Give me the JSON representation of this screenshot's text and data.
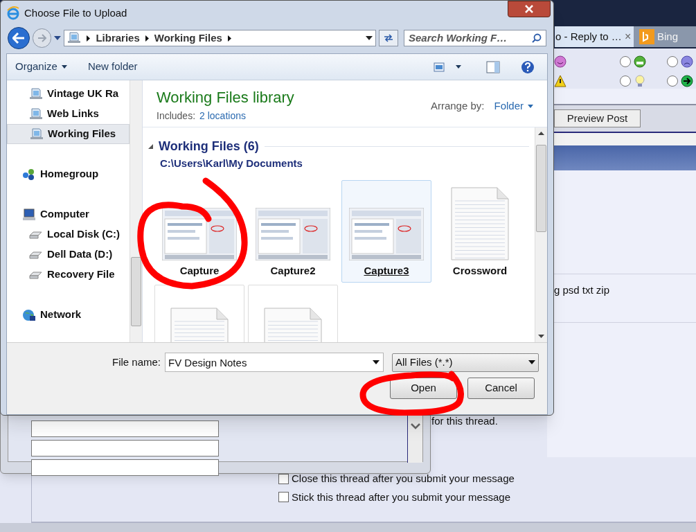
{
  "browser": {
    "tabs": [
      {
        "label": "o - Reply to …",
        "selected": true,
        "close": "×"
      },
      {
        "label": "Bing",
        "selected": false
      }
    ]
  },
  "forum": {
    "smilies": [
      {
        "kind": "pink-smile"
      },
      {
        "kind": "grin",
        "checked": false
      },
      {
        "kind": "sad",
        "checked": false
      },
      {
        "kind": "warning"
      },
      {
        "kind": "bulb",
        "checked": false
      },
      {
        "kind": "arrow",
        "checked": false
      }
    ],
    "preview_button": "Preview Post",
    "extensions_text": "g psd txt zip",
    "thread_text": "for this thread.",
    "options": [
      {
        "label": "Close this thread after you submit your message",
        "checked": false
      },
      {
        "label": "Stick this thread after you submit your message",
        "checked": false
      }
    ]
  },
  "dialog": {
    "title": "Choose File to Upload",
    "breadcrumb": [
      "Libraries",
      "Working Files"
    ],
    "search_placeholder": "Search Working F…",
    "toolbar": [
      "Organize",
      "New folder"
    ],
    "nav": [
      {
        "label": "Vintage UK Ra",
        "kind": "library",
        "selected": false
      },
      {
        "label": "Web Links",
        "kind": "library",
        "selected": false
      },
      {
        "label": "Working Files",
        "kind": "library",
        "selected": true
      },
      {
        "label": "Homegroup",
        "kind": "homegroup",
        "selected": false
      },
      {
        "label": "Computer",
        "kind": "computer",
        "selected": false,
        "children": [
          {
            "label": "Local Disk (C:)",
            "kind": "drive",
            "selected": false
          },
          {
            "label": "Dell Data (D:)",
            "kind": "drive",
            "selected": false
          },
          {
            "label": "Recovery File",
            "kind": "drive",
            "selected": false
          }
        ]
      },
      {
        "label": "Network",
        "kind": "network",
        "selected": false
      }
    ],
    "library_title": "Working Files library",
    "includes_label": "Includes:",
    "includes_link": "2 locations",
    "arrange_label": "Arrange by:",
    "arrange_value": "Folder",
    "group": {
      "title": "Working Files (6)",
      "path": "C:\\Users\\Karl\\My Documents",
      "expanded": true
    },
    "files": [
      {
        "name": "Capture",
        "kind": "screenshot",
        "selected": false
      },
      {
        "name": "Capture2",
        "kind": "screenshot",
        "selected": false
      },
      {
        "name": "Capture3",
        "kind": "screenshot",
        "selected": true
      },
      {
        "name": "Crossword",
        "kind": "document",
        "selected": false
      },
      {
        "kind": "document",
        "selected": false
      },
      {
        "kind": "document",
        "selected": false
      }
    ],
    "file_name_label": "File name:",
    "file_name_value": "FV Design Notes",
    "filter": "All Files (*.*)",
    "buttons": [
      "Open",
      "Cancel"
    ]
  }
}
